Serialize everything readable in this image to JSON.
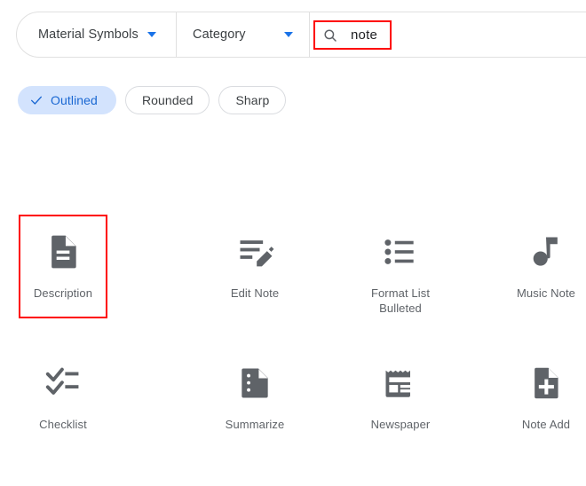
{
  "toolbar": {
    "family_filter": {
      "label": "Material Symbols",
      "icon": "chevron-down-icon"
    },
    "category_filter": {
      "label": "Category",
      "icon": "chevron-down-icon"
    },
    "search": {
      "icon": "search-icon",
      "value": "note",
      "placeholder": "Search icons"
    }
  },
  "style_chips": {
    "selected": "Outlined",
    "items": [
      {
        "label": "Outlined",
        "selected": true,
        "icon": "check-icon"
      },
      {
        "label": "Rounded",
        "selected": false
      },
      {
        "label": "Sharp",
        "selected": false
      }
    ]
  },
  "results": {
    "highlighted": "Description",
    "icons": [
      {
        "label": "Description",
        "icon": "description-icon",
        "highlighted": true
      },
      {
        "label": "Edit Note",
        "icon": "edit-note-icon",
        "highlighted": false
      },
      {
        "label": "Format List Bulleted",
        "icon": "format-list-bulleted-icon",
        "highlighted": false
      },
      {
        "label": "Music Note",
        "icon": "music-note-icon",
        "highlighted": false
      },
      {
        "label": "Checklist",
        "icon": "checklist-icon",
        "highlighted": false
      },
      {
        "label": "Summarize",
        "icon": "summarize-icon",
        "highlighted": false
      },
      {
        "label": "Newspaper",
        "icon": "newspaper-icon",
        "highlighted": false
      },
      {
        "label": "Note Add",
        "icon": "note-add-icon",
        "highlighted": false
      }
    ]
  },
  "colors": {
    "accent_blue": "#1a73e8",
    "chip_selected_bg": "#d3e3fd",
    "chip_selected_text": "#1967d2",
    "icon_gray": "#5f6368",
    "label_gray": "#5f6368",
    "annotation_red": "#fe0000",
    "border_gray": "#e0e0e0"
  }
}
